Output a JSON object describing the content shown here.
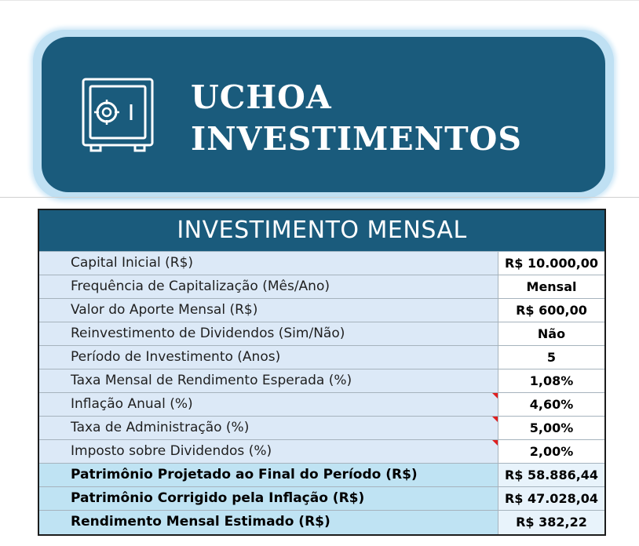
{
  "brand": {
    "line1": "UCHOA",
    "line2": "INVESTIMENTOS",
    "icon": "safe-icon",
    "color": "#1a5b7c"
  },
  "table": {
    "title": "INVESTIMENTO MENSAL",
    "rows": [
      {
        "label": "Capital Inicial (R$)",
        "value": "R$ 10.000,00"
      },
      {
        "label": "Frequência de Capitalização (Mês/Ano)",
        "value": "Mensal"
      },
      {
        "label": "Valor do Aporte Mensal (R$)",
        "value": "R$ 600,00"
      },
      {
        "label": "Reinvestimento de Dividendos (Sim/Não)",
        "value": "Não"
      },
      {
        "label": "Período de Investimento (Anos)",
        "value": "5"
      },
      {
        "label": "Taxa Mensal de Rendimento Esperada (%)",
        "value": "1,08%"
      },
      {
        "label": "Inflação Anual (%)",
        "value": "4,60%"
      },
      {
        "label": "Taxa de Administração (%)",
        "value": "5,00%"
      },
      {
        "label": "Imposto sobre Dividendos (%)",
        "value": "2,00%"
      }
    ],
    "totals": [
      {
        "label": "Patrimônio Projetado ao Final do Período (R$)",
        "value": "R$ 58.886,44"
      },
      {
        "label": "Patrimônio Corrigido pela Inflação (R$)",
        "value": "R$ 47.028,04"
      },
      {
        "label": "Rendimento Mensal Estimado (R$)",
        "value": "R$ 382,22"
      }
    ]
  }
}
